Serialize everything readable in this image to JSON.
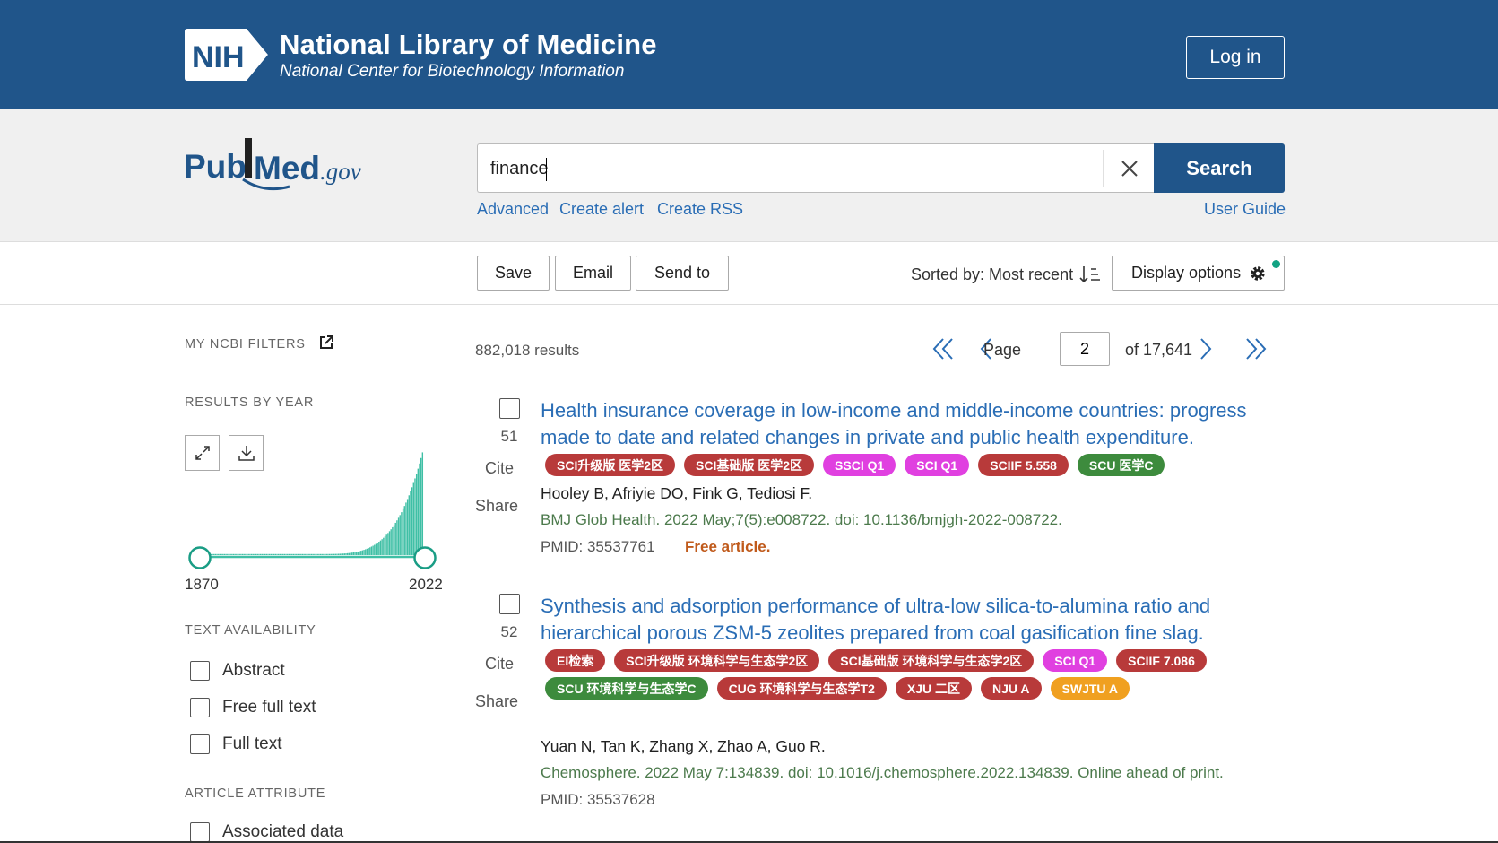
{
  "header": {
    "logo_text": "NIH",
    "title": "National Library of Medicine",
    "subtitle": "National Center for Biotechnology Information",
    "login_label": "Log in"
  },
  "brand": {
    "pubmed_logo_text": "PubMed.gov",
    "colors": {
      "nih_blue": "#20558a",
      "link_blue": "#2a6db5",
      "journal_green": "#4c7a4c",
      "free_orange": "#c05a1b",
      "histogram_teal": "#3fbfa5"
    }
  },
  "search": {
    "value": "finance",
    "button_label": "Search",
    "links": {
      "advanced": "Advanced",
      "create_alert": "Create alert",
      "create_rss": "Create RSS",
      "user_guide": "User Guide"
    }
  },
  "actions": {
    "save": "Save",
    "email": "Email",
    "send_to": "Send to",
    "sorted_by": "Sorted by: Most recent",
    "display_options": "Display options"
  },
  "sidebar": {
    "my_ncbi_filters": "MY NCBI FILTERS",
    "results_by_year": "RESULTS BY YEAR",
    "year_start": "1870",
    "year_end": "2022",
    "text_availability": "TEXT AVAILABILITY",
    "filters": [
      "Abstract",
      "Free full text",
      "Full text"
    ],
    "article_attribute": "ARTICLE ATTRIBUTE",
    "article_attribute_items": [
      "Associated data"
    ]
  },
  "results": {
    "count": "882,018 results",
    "page_label": "Page",
    "page_value": "2",
    "page_of": "of 17,641",
    "cite_label": "Cite",
    "share_label": "Share",
    "items": [
      {
        "number": "51",
        "title_line1": "Health insurance coverage in low-income and middle-income countries: progress",
        "title_line2": "made to date and related changes in private and public health expenditure.",
        "badges": [
          {
            "text": "SCI升级版 医学2区",
            "color": "#b83a3a"
          },
          {
            "text": "SCI基础版 医学2区",
            "color": "#b83a3a"
          },
          {
            "text": "SSCI Q1",
            "color": "#e040e0"
          },
          {
            "text": "SCI Q1",
            "color": "#e040e0"
          },
          {
            "text": "SCIIF 5.558",
            "color": "#b83a3a"
          },
          {
            "text": "SCU 医学C",
            "color": "#3d8b3d"
          }
        ],
        "authors": "Hooley B, Afriyie DO, Fink G, Tediosi F.",
        "journal": "BMJ Glob Health. 2022 May;7(5):e008722. doi: 10.1136/bmjgh-2022-008722.",
        "pmid": "PMID: 35537761",
        "free": "Free article."
      },
      {
        "number": "52",
        "title_line1": "Synthesis and adsorption performance of ultra-low silica-to-alumina ratio and",
        "title_line2": "hierarchical porous ZSM-5 zeolites prepared from coal gasification fine slag.",
        "badges": [
          {
            "text": "EI检索",
            "color": "#b83a3a"
          },
          {
            "text": "SCI升级版 环境科学与生态学2区",
            "color": "#b83a3a"
          },
          {
            "text": "SCI基础版 环境科学与生态学2区",
            "color": "#b83a3a"
          },
          {
            "text": "SCI Q1",
            "color": "#e040e0"
          },
          {
            "text": "SCIIF 7.086",
            "color": "#b83a3a"
          },
          {
            "text": "SCU 环境科学与生态学C",
            "color": "#3d8b3d"
          },
          {
            "text": "CUG 环境科学与生态学T2",
            "color": "#b83a3a"
          },
          {
            "text": "XJU 二区",
            "color": "#b83a3a"
          },
          {
            "text": "NJU A",
            "color": "#b83a3a"
          },
          {
            "text": "SWJTU A",
            "color": "#f0a020"
          }
        ],
        "authors": "Yuan N, Tan K, Zhang X, Zhao A, Guo R.",
        "journal": "Chemosphere. 2022 May 7:134839. doi: 10.1016/j.chemosphere.2022.134839. Online ahead of print.",
        "pmid": "PMID: 35537628"
      }
    ]
  }
}
